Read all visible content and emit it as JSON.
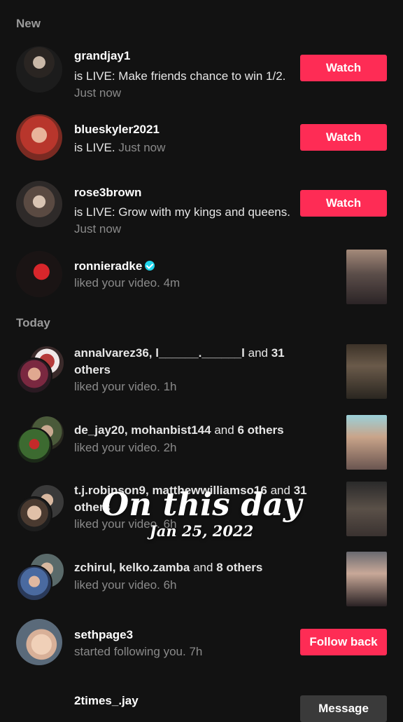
{
  "sections": {
    "new": "New",
    "today": "Today"
  },
  "items": [
    {
      "name": "grandjay1",
      "text": "is LIVE: Make friends chance to win 1/2.",
      "time": "Just now",
      "action": "Watch"
    },
    {
      "name": "blueskyler2021",
      "text": "is LIVE.",
      "time": "Just now",
      "action": "Watch"
    },
    {
      "name": "rose3brown",
      "text": "is LIVE: Grow with my kings and queens.",
      "time": "Just now",
      "action": "Watch"
    },
    {
      "name": "ronnieradke",
      "text": "liked your video.",
      "time": "4m"
    },
    {
      "name": "annalvarez36, l______.______l",
      "extra": "and",
      "count": "31",
      "others": "others",
      "text": "liked your video.",
      "time": "1h"
    },
    {
      "name": "de_jay20, mohanbist144",
      "extra": "and",
      "count": "6",
      "others": "others",
      "text": "liked your video.",
      "time": "2h"
    },
    {
      "name": "t.j.robinson9, matthewwilliamso16",
      "extra": "and",
      "count": "31",
      "others": "others",
      "text": "liked your video.",
      "time": "6h"
    },
    {
      "name": "zchirul, kelko.zamba",
      "extra": "and",
      "count": "8",
      "others": "others",
      "text": "liked your video.",
      "time": "6h"
    },
    {
      "name": "sethpage3",
      "text": "started following you.",
      "time": "7h",
      "action": "Follow back"
    },
    {
      "name": "2times_.jay",
      "action": "Message"
    }
  ],
  "overlay": {
    "title": "On this day",
    "date": "Jan 25, 2022"
  },
  "colors": {
    "accent": "#fe2c55",
    "verified": "#20d5ec",
    "background": "#121212"
  }
}
